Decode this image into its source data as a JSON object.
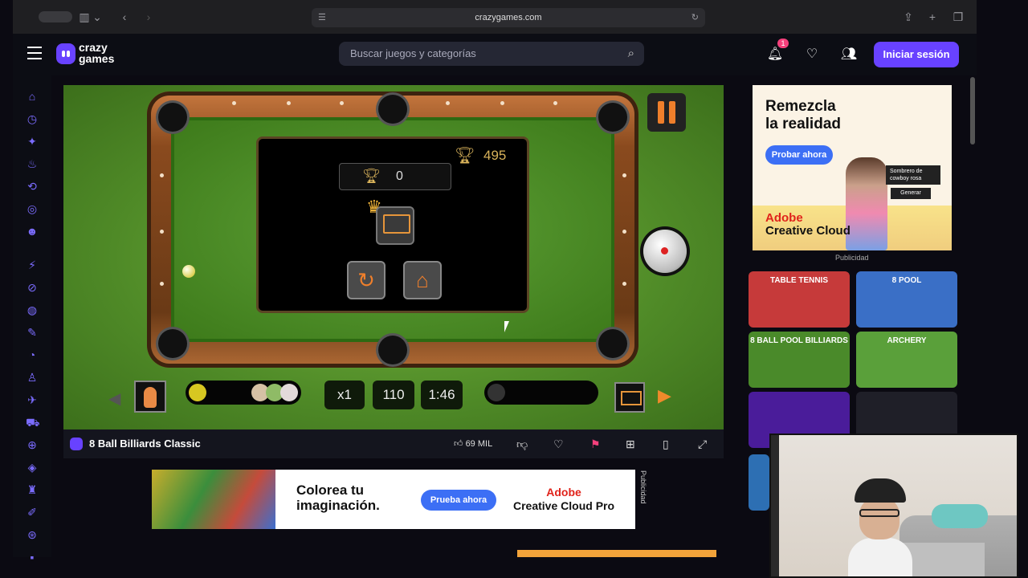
{
  "browser": {
    "url": "crazygames.com"
  },
  "header": {
    "logo_top": "crazy",
    "logo_bottom": "games",
    "search_placeholder": "Buscar juegos y categorías",
    "notification_count": "1",
    "login_label": "Iniciar sesión"
  },
  "game": {
    "best_score": "495",
    "current_score": "0",
    "multiplier": "x1",
    "points": "110",
    "timer": "1:46"
  },
  "game_bar": {
    "title": "8 Ball Billiards Classic",
    "likes": "69 MIL"
  },
  "ad_right": {
    "headline_1": "Remezcla",
    "headline_2": "la realidad",
    "cta": "Probar ahora",
    "chip_text": "Sombrero de cowboy rosa",
    "generate": "Generar",
    "brand_line_1": "Adobe",
    "brand_line_2": "Creative Cloud",
    "label": "Publicidad"
  },
  "ad_bottom": {
    "headline_1": "Colorea tu",
    "headline_2": "imaginación.",
    "cta": "Prueba ahora",
    "brand_line_1": "Adobe",
    "brand_line_2": "Creative Cloud Pro",
    "label": "Publicidad"
  },
  "thumbnails": [
    {
      "title": "TABLE TENNIS",
      "color": "#c63a3a"
    },
    {
      "title": "8 POOL",
      "color": "#3a6fc6"
    },
    {
      "title": "8 BALL POOL BILLIARDS",
      "color": "#4a8a2a"
    },
    {
      "title": "ARCHERY",
      "color": "#5aa03a"
    },
    {
      "title": "",
      "color": "#4a1c9a"
    },
    {
      "title": "",
      "color": "#1f1f28"
    }
  ],
  "colors": {
    "brand": "#6842ff",
    "accent_orange": "#ef7f2b",
    "notif_badge": "#f5407c"
  }
}
